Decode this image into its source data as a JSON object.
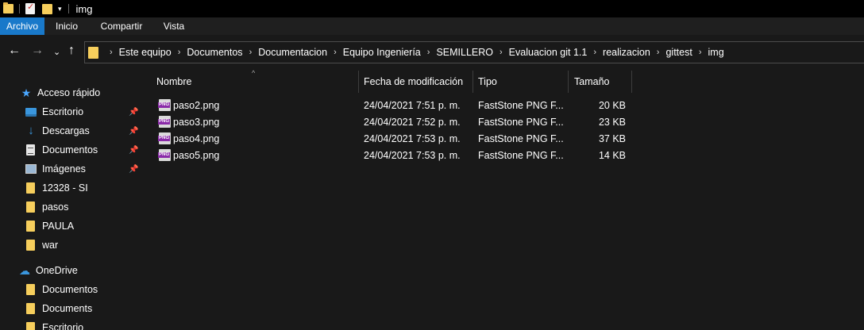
{
  "window": {
    "title": "img"
  },
  "ribbon": {
    "tabs": [
      "Archivo",
      "Inicio",
      "Compartir",
      "Vista"
    ]
  },
  "address": {
    "breadcrumbs": [
      "Este equipo",
      "Documentos",
      "Documentacion",
      "Equipo Ingeniería",
      "SEMILLERO",
      "Evaluacion git 1.1",
      "realizacion",
      "gittest",
      "img"
    ]
  },
  "sidebar": {
    "quick_access": {
      "label": "Acceso rápido"
    },
    "items": [
      {
        "label": "Escritorio",
        "icon": "desktop-icon",
        "pinned": true
      },
      {
        "label": "Descargas",
        "icon": "download-icon",
        "pinned": true
      },
      {
        "label": "Documentos",
        "icon": "documents-icon",
        "pinned": true
      },
      {
        "label": "Imágenes",
        "icon": "pictures-icon",
        "pinned": true
      },
      {
        "label": "12328 - SI",
        "icon": "folder-icon",
        "pinned": false
      },
      {
        "label": "pasos",
        "icon": "folder-icon",
        "pinned": false
      },
      {
        "label": "PAULA",
        "icon": "folder-icon",
        "pinned": false
      },
      {
        "label": "war",
        "icon": "folder-icon",
        "pinned": false
      }
    ],
    "onedrive": {
      "label": "OneDrive",
      "items": [
        {
          "label": "Documentos",
          "icon": "folder-icon"
        },
        {
          "label": "Documents",
          "icon": "folder-icon"
        },
        {
          "label": "Escritorio",
          "icon": "folder-icon"
        }
      ]
    }
  },
  "columns": {
    "name": "Nombre",
    "date": "Fecha de modificación",
    "type": "Tipo",
    "size": "Tamaño"
  },
  "files": [
    {
      "name": "paso2.png",
      "date": "24/04/2021 7:51 p. m.",
      "type": "FastStone PNG F...",
      "size": "20 KB"
    },
    {
      "name": "paso3.png",
      "date": "24/04/2021 7:52 p. m.",
      "type": "FastStone PNG F...",
      "size": "23 KB"
    },
    {
      "name": "paso4.png",
      "date": "24/04/2021 7:53 p. m.",
      "type": "FastStone PNG F...",
      "size": "37 KB"
    },
    {
      "name": "paso5.png",
      "date": "24/04/2021 7:53 p. m.",
      "type": "FastStone PNG F...",
      "size": "14 KB"
    }
  ],
  "colors": {
    "accent": "#1979ca",
    "folder": "#f6ce5c",
    "background": "#191919"
  }
}
